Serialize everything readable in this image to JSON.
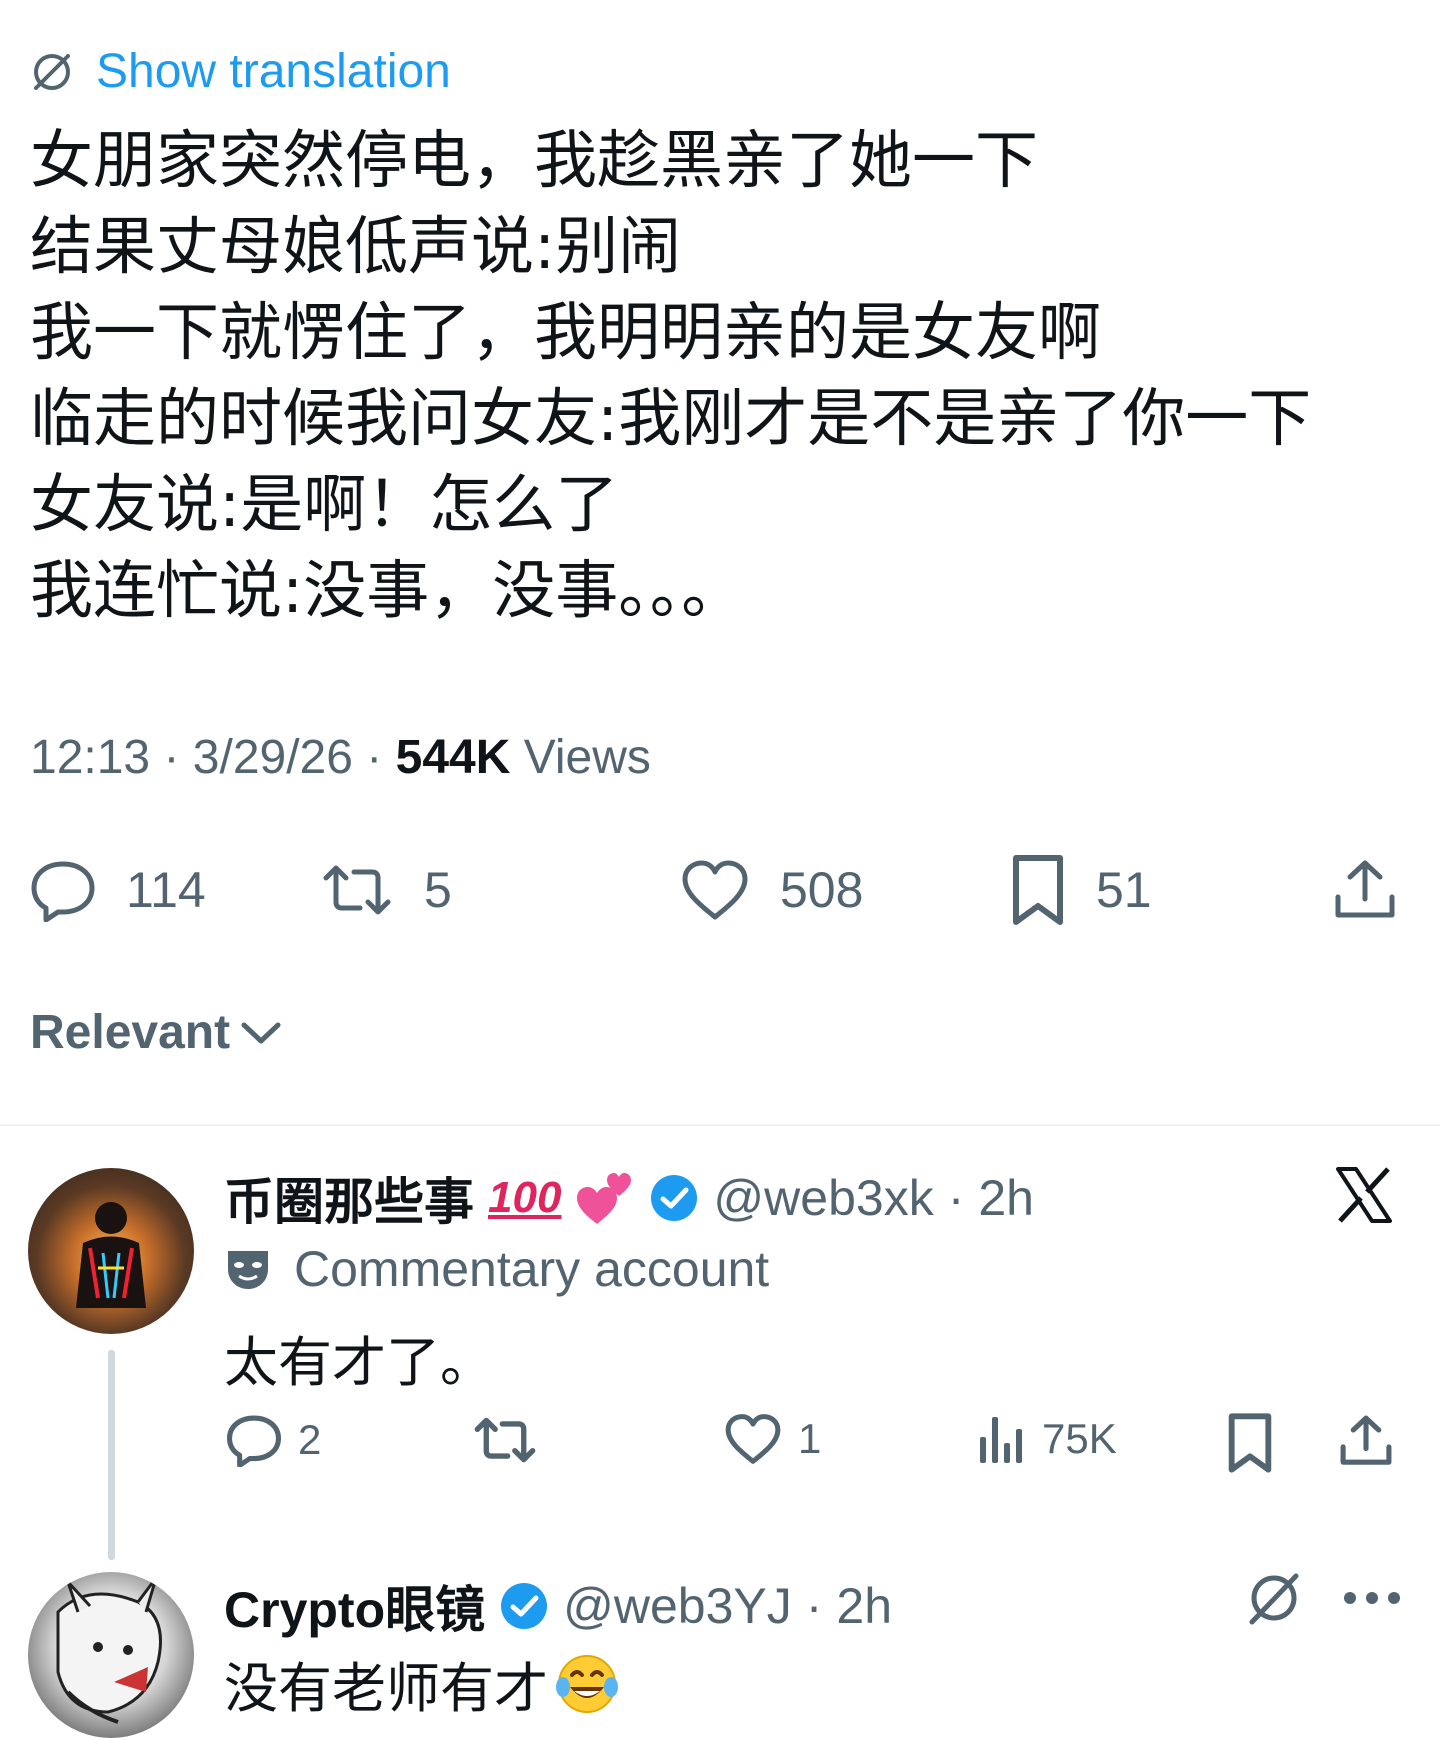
{
  "tweet": {
    "show_translation": "Show translation",
    "lines": [
      "女朋家突然停电，我趁黑亲了她一下",
      "结果丈母娘低声说:别闹",
      "我一下就愣住了，我明明亲的是女友啊",
      "临走的时候我问女友:我刚才是不是亲了你一下",
      "女友说:是啊！怎么了",
      "我连忙说:没事，没事。。。"
    ],
    "time": "12:13",
    "date": "3/29/26",
    "views_count": "544K",
    "views_label": "Views",
    "replies": "114",
    "reposts": "5",
    "likes": "508",
    "bookmarks": "51"
  },
  "sort": {
    "label": "Relevant"
  },
  "replies": [
    {
      "name": "币圈那些事",
      "handle": "@web3xk",
      "time": "2h",
      "badge": "Commentary account",
      "text": "太有才了。",
      "reply_count": "2",
      "like_count": "1",
      "views": "75K"
    },
    {
      "name": "Crypto眼镜",
      "handle": "@web3YJ",
      "time": "2h",
      "text": "没有老师有才"
    }
  ],
  "colors": {
    "accent": "#1d9bf0",
    "muted": "#536471",
    "text": "#0f1419",
    "verified": "#1d9bf0"
  }
}
